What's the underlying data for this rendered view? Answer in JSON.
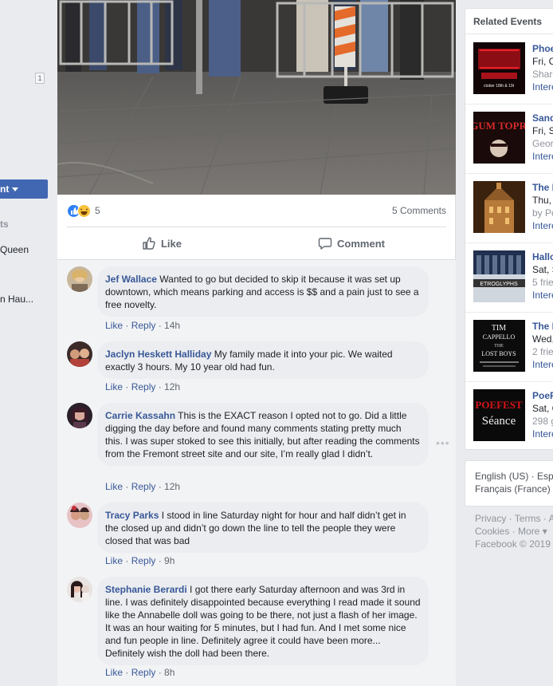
{
  "left_sidebar": {
    "badge_count": "1",
    "create_button_label": "nt",
    "section_label": "ts",
    "item_1": "Queen",
    "item_2": "n Hau..."
  },
  "post": {
    "reaction_count": "5",
    "comment_count_label": "5 Comments",
    "like_label": "Like",
    "comment_label": "Comment"
  },
  "comments": [
    {
      "name": "Jef Wallace",
      "text": "Wanted to go but decided to skip it because it was set up downtown, which means parking and access is $$ and a pain just to see a free novelty.",
      "like": "Like",
      "reply": "Reply",
      "time": "14h"
    },
    {
      "name": "Jaclyn Heskett Halliday",
      "text": "My family made it into your pic. We waited exactly 3 hours. My 10 year old had fun.",
      "like": "Like",
      "reply": "Reply",
      "time": "12h"
    },
    {
      "name": "Carrie Kassahn",
      "text": "This is the EXACT reason I opted not to go. Did a little digging the day before and found many comments stating pretty much this. I was super stoked to see this initially, but after reading the comments from the Fremont street site and our site, I’m really glad I didn’t.",
      "like": "Like",
      "reply": "Reply",
      "time": "12h"
    },
    {
      "name": "Tracy Parks",
      "text": "I stood in line Saturday night for hour and half didn’t get in the closed up and didn’t go down the line to tell the people they were closed that was bad",
      "like": "Like",
      "reply": "Reply",
      "time": "9h"
    },
    {
      "name": "Stephanie Berardi",
      "text": "I got there early Saturday afternoon and was 3rd in line. I was definitely disappointed because everything I read made it sound like the Annabelle doll was going to be there, not just a flash of her image. It was an hour waiting for 5 minutes, but I had fun. And I met some nice and fun people in line. Definitely agree it could have been more... Definitely wish the doll had been there.",
      "like": "Like",
      "reply": "Reply",
      "time": "8h"
    }
  ],
  "related_events": {
    "header": "Related Events",
    "events": [
      {
        "title": "Phoe",
        "date": "Fri, C",
        "sub": "Share",
        "interest": "Intere",
        "image_text": "ctober 18th & 19t"
      },
      {
        "title": "Sand",
        "date": "Fri, S",
        "sub": "Geor",
        "interest": "Intere",
        "image_text": "OMGUM TOPROW"
      },
      {
        "title": "The I",
        "date": "Thu,",
        "sub": "by Po",
        "interest": "Intere",
        "image_text": ""
      },
      {
        "title": "Hallo",
        "date": "Sat, S",
        "sub": "5 frie",
        "interest": "Intere",
        "image_text": "ETROGLYPHS"
      },
      {
        "title": "The I",
        "date": "Wed,",
        "sub": "2 frie",
        "interest": "Intere",
        "image_text_1": "TIM",
        "image_text_2": "CAPPELLO",
        "image_text_3": "THE",
        "image_text_4": "LOST BOYS"
      },
      {
        "title": "PoeF",
        "date": "Sat, C",
        "sub": "298 g",
        "interest": "Intere",
        "image_text_1": "POEFEST",
        "image_text_2": "Séance"
      }
    ]
  },
  "languages": {
    "line_1": "English (US) · Esp",
    "line_2": "Français (France)"
  },
  "footer": {
    "line_1": "Privacy · Terms · A",
    "line_2": "Cookies · More ▾",
    "line_3": "Facebook © 2019"
  },
  "colors": {
    "link_blue": "#385898",
    "button_blue": "#4267b2",
    "bubble_gray": "#ebedf0",
    "page_bg": "#e9ebee"
  }
}
